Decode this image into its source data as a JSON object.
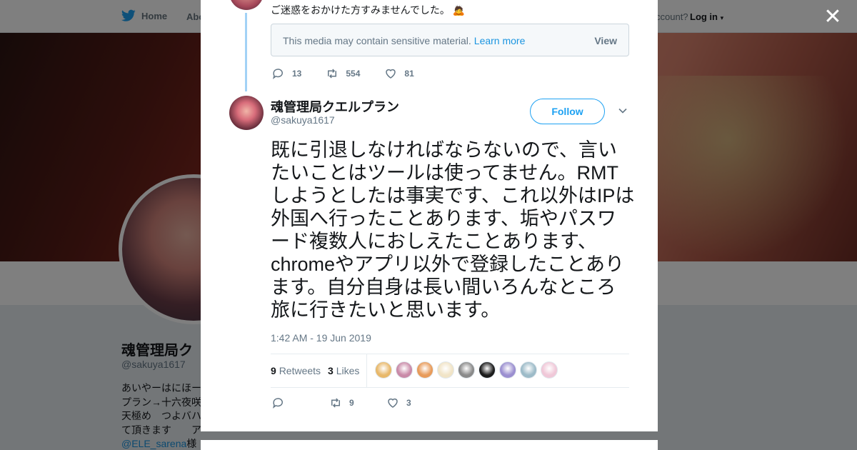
{
  "nav": {
    "home": "Home",
    "about": "Abo",
    "account": "ccount?",
    "login": "Log in"
  },
  "profile": {
    "name": "魂管理局ク",
    "handle": "@sakuya1617",
    "bio_lines": [
      "あいやーはにほー",
      "プラン→十六夜咲",
      "天極め　つよバハ",
      "て頂きます　　ア",
      "@ELE_sarena"
    ],
    "bio_link_after": "様"
  },
  "previous_tweet": {
    "text": "ご迷惑をおかけた方すみませんでした。",
    "media_warning": "This media may contain sensitive material.",
    "learn_more": "Learn more",
    "view": "View",
    "replies": "13",
    "retweets": "554",
    "likes": "81"
  },
  "tweet": {
    "name": "魂管理局クエルプラン",
    "handle": "@sakuya1617",
    "follow": "Follow",
    "text": "既に引退しなければならないので、言いたいことはツールは使ってません。RMTしようとしたは事実です、これ以外はIPは外国へ行ったことあります、垢やパスワード複数人におしえたことあります、chromeやアプリ以外で登録したことあります。自分自身は長い間いろんなところ旅に行きたいと思います。",
    "timestamp": "1:42 AM - 19 Jun 2019",
    "retweet_count": "9",
    "retweet_label": "Retweets",
    "like_count": "3",
    "like_label": "Likes",
    "action_retweets": "9",
    "action_likes": "3"
  },
  "colors": {
    "accent": "#1da1f2",
    "thread_line": "#a2d2f6",
    "text_primary": "#14171a",
    "text_secondary": "#657786"
  },
  "likers": [
    {
      "color": "#e8b86a"
    },
    {
      "color": "#c98aa8"
    },
    {
      "color": "#e89b5a"
    },
    {
      "color": "#f1e4c7"
    },
    {
      "color": "#8a8a8a"
    },
    {
      "color": "#1c1c1c"
    },
    {
      "color": "#9b8fd0"
    },
    {
      "color": "#9dbbc8"
    },
    {
      "color": "#f0c8d8"
    }
  ]
}
